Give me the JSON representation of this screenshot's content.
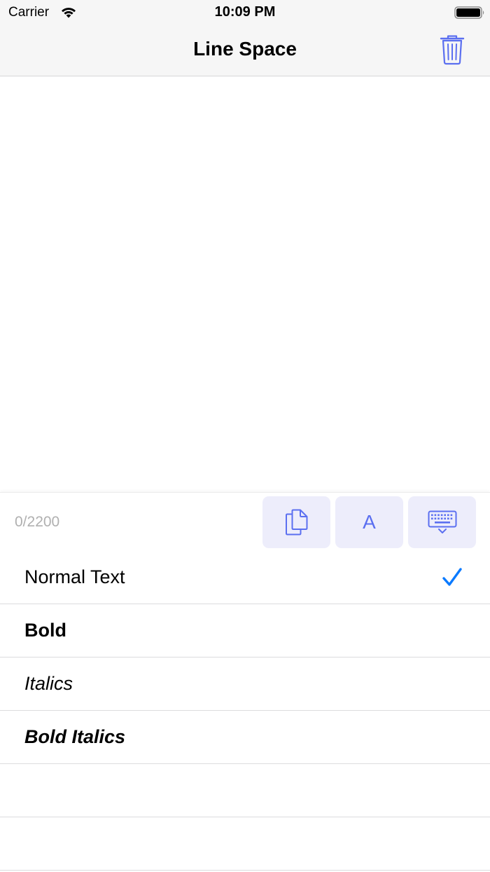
{
  "status_bar": {
    "carrier": "Carrier",
    "time": "10:09 PM"
  },
  "nav": {
    "title": "Line Space",
    "trash_icon": "trash-icon"
  },
  "editor": {
    "text": ""
  },
  "toolbar": {
    "char_count": "0/2200",
    "buttons": [
      {
        "name": "copy",
        "icon": "copy-icon"
      },
      {
        "name": "font",
        "label": "A"
      },
      {
        "name": "keyboard",
        "icon": "keyboard-icon"
      }
    ]
  },
  "styles": {
    "items": [
      {
        "label": "Normal Text",
        "selected": true
      },
      {
        "label": "Bold",
        "selected": false
      },
      {
        "label": "Italics",
        "selected": false
      },
      {
        "label": "Bold Italics",
        "selected": false
      }
    ]
  },
  "colors": {
    "accent": "#5b6ff0",
    "checkmark": "#0a7aff",
    "button_bg": "#ededfb",
    "bar_bg": "#f6f6f6"
  }
}
